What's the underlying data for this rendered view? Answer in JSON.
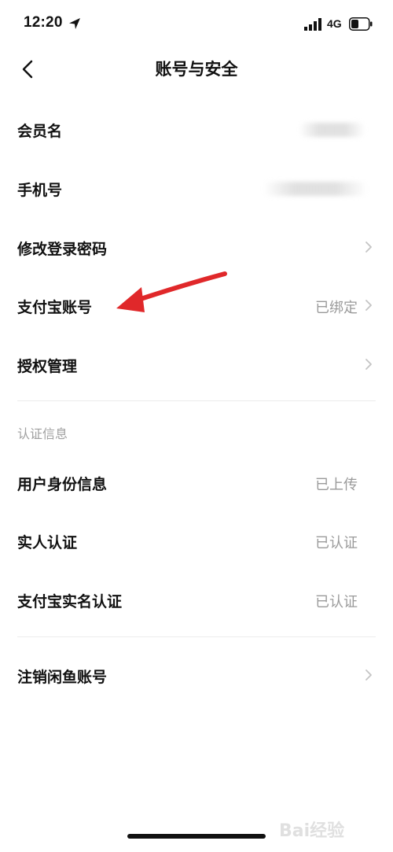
{
  "status_bar": {
    "time": "12:20",
    "network": "4G",
    "icons": [
      "location-arrow-icon",
      "signal-icon",
      "battery-icon"
    ]
  },
  "nav": {
    "back_icon": "chevron-left-icon",
    "title": "账号与安全"
  },
  "account_rows": [
    {
      "label": "会员名",
      "value": "",
      "value_obscured": true,
      "chevron": false
    },
    {
      "label": "手机号",
      "value": "",
      "value_obscured": true,
      "chevron": false
    },
    {
      "label": "修改登录密码",
      "value": "",
      "chevron": true
    },
    {
      "label": "支付宝账号",
      "value": "已绑定",
      "chevron": true
    },
    {
      "label": "授权管理",
      "value": "",
      "chevron": true
    }
  ],
  "verification_section": {
    "header": "认证信息",
    "rows": [
      {
        "label": "用户身份信息",
        "value": "已上传",
        "chevron": false
      },
      {
        "label": "实人认证",
        "value": "已认证",
        "chevron": false
      },
      {
        "label": "支付宝实名认证",
        "value": "已认证",
        "chevron": false
      }
    ]
  },
  "footer_rows": [
    {
      "label": "注销闲鱼账号",
      "value": "",
      "chevron": true
    }
  ],
  "annotation": {
    "arrow_color": "#e0282a",
    "points_to": "支付宝账号"
  },
  "watermark": {
    "text": "Bai经验"
  },
  "colors": {
    "text_primary": "#111111",
    "text_secondary": "#9a9a9a",
    "divider": "#ececec",
    "background": "#ffffff"
  }
}
